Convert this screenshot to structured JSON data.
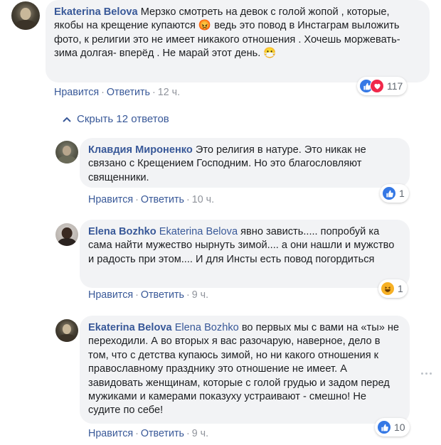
{
  "comments": [
    {
      "author": "Ekaterina Belova",
      "text": "Мерзко смотреть на девок с голой жопой , которые, якобы на крещение купаются 😡 ведь это повод в Инстаграм выложить фото, к религии это не имеет никакого отношения . Хочешь моржевать- зима долгая- вперёд . Не марай этот день. 😷",
      "like": "Нравится",
      "reply": "Ответить",
      "time": "12 ч.",
      "reactions_count": "117"
    },
    {
      "author": "Клавдия Мироненко",
      "text": "Это религия в натуре. Это никак не связано с Крещением Господним. Но это благословляют священники.",
      "like": "Нравится",
      "reply": "Ответить",
      "time": "10 ч.",
      "reactions_count": "1"
    },
    {
      "author": "Elena Bozhko",
      "mention": "Ekaterina Belova",
      "text": "явно зависть..... попробуй ка сама найти мужество нырнуть зимой.... а они нашли и мужство и радость при этом.... И для Инсты есть повод погордиться",
      "like": "Нравится",
      "reply": "Ответить",
      "time": "9 ч.",
      "reactions_count": "1"
    },
    {
      "author": "Ekaterina Belova",
      "mention": "Elena Bozhko",
      "text": "во первых мы с вами на «ты» не переходили. А во вторых я вас разочарую, наверное, дело в том, что с детства купаюсь зимой, но ни какого отношения к православному празднику это отношение не имеет. А завидовать женщинам, которые с голой грудью и задом перед мужиками и камерами показуху устраивают - смешно! Не судите по себе!",
      "like": "Нравится",
      "reply": "Ответить",
      "time": "9 ч.",
      "reactions_count": "10"
    }
  ],
  "hide_replies": "Скрыть 12 ответов",
  "separator": "·",
  "colors": {
    "link": "#385898",
    "bubble": "#f2f3f5",
    "like": "#3578e5",
    "love": "#f0284a",
    "haha": "#f7b125"
  },
  "icons": {
    "like": "thumbs-up-icon",
    "love": "heart-icon",
    "haha": "laughing-face-icon",
    "collapse": "chevron-up-icon",
    "more": "more-options-icon"
  }
}
